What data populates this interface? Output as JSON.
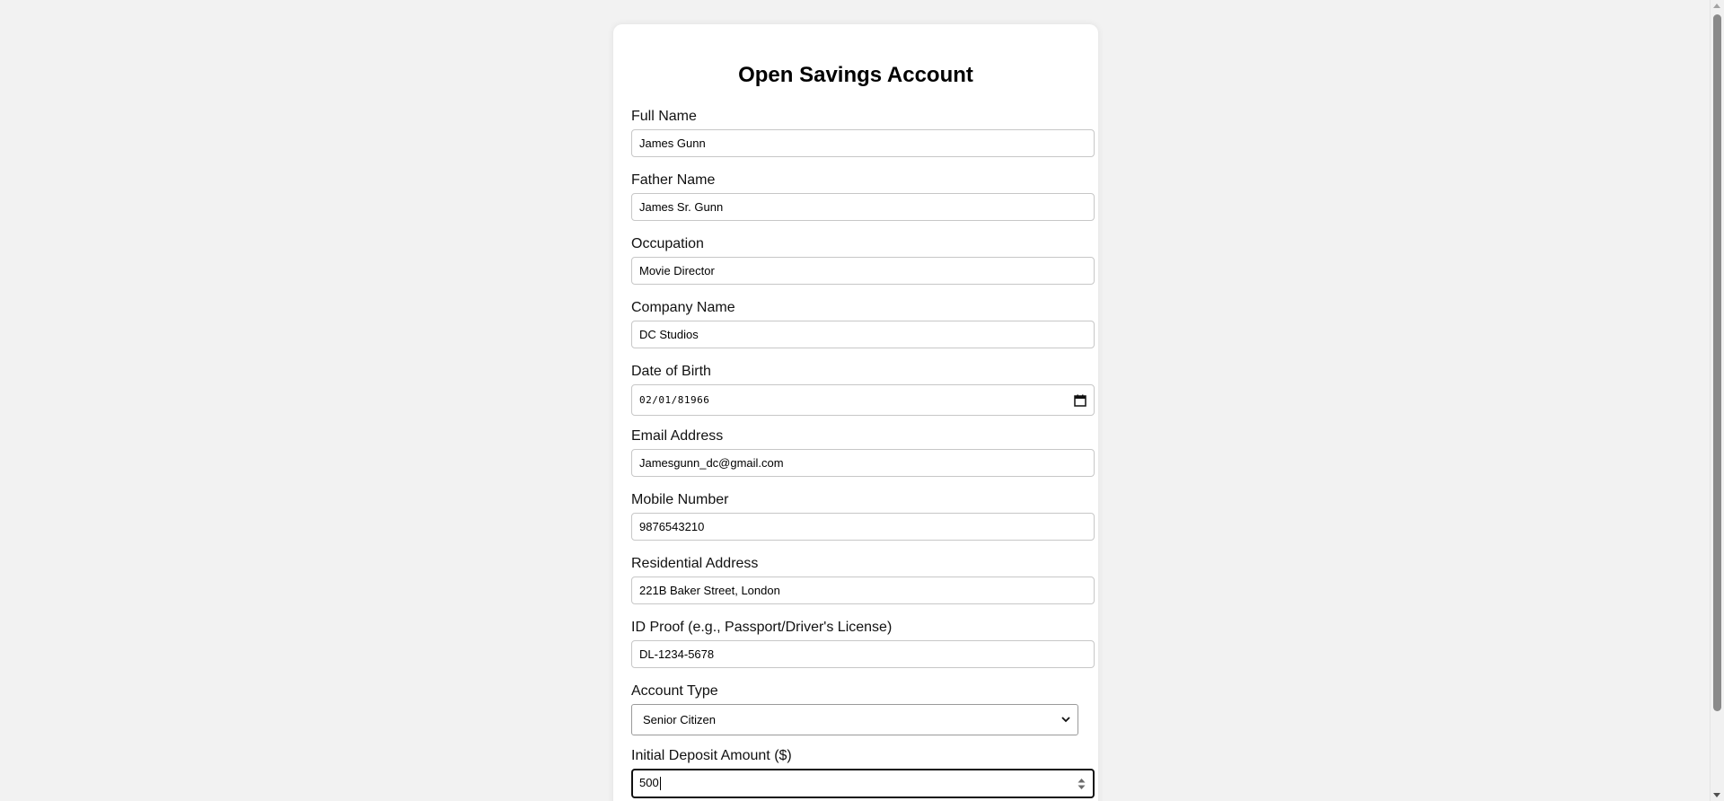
{
  "form": {
    "title": "Open Savings Account",
    "fields": {
      "full_name": {
        "label": "Full Name",
        "value": "James Gunn"
      },
      "father_name": {
        "label": "Father Name",
        "value": "James Sr. Gunn"
      },
      "occupation": {
        "label": "Occupation",
        "value": "Movie Director"
      },
      "company_name": {
        "label": "Company Name",
        "value": "DC Studios"
      },
      "dob": {
        "label": "Date of Birth",
        "value": "02/01/81966"
      },
      "email": {
        "label": "Email Address",
        "value": "Jamesgunn_dc@gmail.com"
      },
      "mobile": {
        "label": "Mobile Number",
        "value": "9876543210"
      },
      "address": {
        "label": "Residential Address",
        "value": "221B Baker Street, London"
      },
      "id_proof": {
        "label": "ID Proof (e.g., Passport/Driver's License)",
        "value": "DL-1234-5678"
      },
      "account_type": {
        "label": "Account Type",
        "value": "Senior Citizen"
      },
      "deposit": {
        "label": "Initial Deposit Amount ($)",
        "value": "500"
      }
    }
  },
  "icons": {
    "calendar": "calendar-icon",
    "dropdown": "chevron-down-icon",
    "spinner": "spinner-arrows-icon"
  },
  "colors": {
    "page_background": "#f2f2f2",
    "card_background": "#ffffff",
    "input_border": "#c7c7c7",
    "focus_border": "#111111"
  }
}
